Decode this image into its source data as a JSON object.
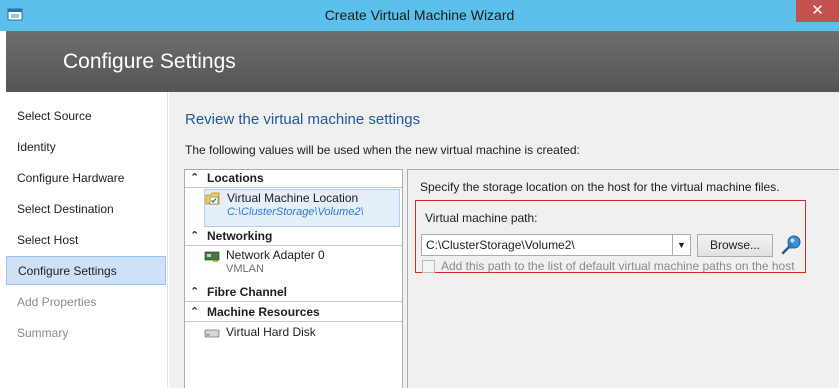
{
  "window": {
    "title": "Create Virtual Machine Wizard",
    "close_glyph": "✕",
    "icon": "wizard-app-icon"
  },
  "banner": {
    "title": "Configure Settings"
  },
  "nav": {
    "items": [
      {
        "label": "Select Source",
        "state": "normal"
      },
      {
        "label": "Identity",
        "state": "normal"
      },
      {
        "label": "Configure Hardware",
        "state": "normal"
      },
      {
        "label": "Select Destination",
        "state": "normal"
      },
      {
        "label": "Select Host",
        "state": "normal"
      },
      {
        "label": "Configure Settings",
        "state": "selected"
      },
      {
        "label": "Add Properties",
        "state": "disabled"
      },
      {
        "label": "Summary",
        "state": "disabled"
      }
    ]
  },
  "main": {
    "heading": "Review the virtual machine settings",
    "intro": "The following values will be used when the new virtual machine is created:"
  },
  "tree": {
    "chevron": "⌃",
    "categories": [
      {
        "label": "Locations"
      },
      {
        "label": "Networking"
      },
      {
        "label": "Fibre Channel"
      },
      {
        "label": "Machine Resources"
      }
    ],
    "items": [
      {
        "label": "Virtual Machine Location",
        "sub": "C:\\ClusterStorage\\Volume2\\",
        "icon": "folder-check-icon"
      },
      {
        "label": "Network Adapter 0",
        "sub": "VMLAN",
        "icon": "network-adapter-icon"
      },
      {
        "label": "Virtual Hard Disk",
        "sub": "",
        "icon": "hard-disk-icon"
      }
    ]
  },
  "detail": {
    "description": "Specify the storage location on the host for the virtual machine files.",
    "path_label": "Virtual machine path:",
    "path_value": "C:\\ClusterStorage\\Volume2\\",
    "browse_label": "Browse...",
    "checkbox_label": "Add this path to the list of default virtual machine paths on the host",
    "checkbox_checked": false
  },
  "colors": {
    "titlebar": "#5bc1ea",
    "heading": "#1e5aa0",
    "highlight_box": "#d12b2b",
    "selected_nav": "#cfe1f7"
  }
}
